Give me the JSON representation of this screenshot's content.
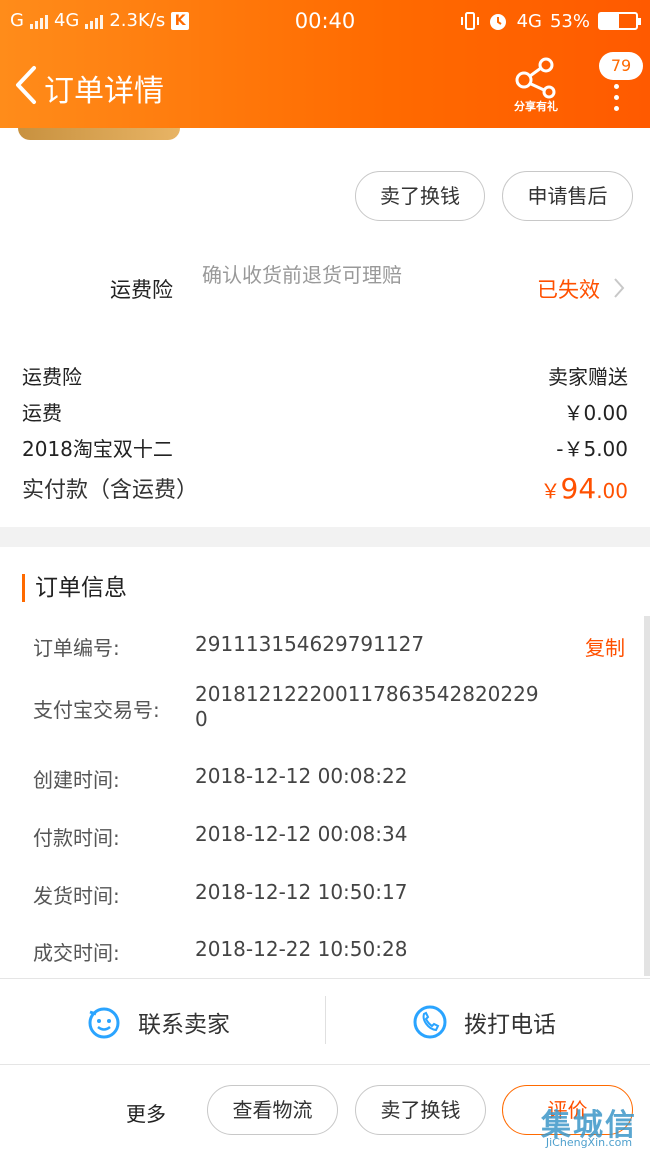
{
  "status_bar": {
    "network_left": "G",
    "network_mid": "4G",
    "speed": "2.3K/s",
    "k_badge": "K",
    "time": "00:40",
    "network_right": "4G",
    "battery": "53%",
    "battery_level": 0.53
  },
  "nav": {
    "title": "订单详情",
    "share_label": "分享有礼",
    "message_count": "79"
  },
  "actions_top": {
    "sell_exchange": "卖了换钱",
    "after_sale": "申请售后"
  },
  "insurance": {
    "label": "运费险",
    "description": "确认收货前退货可理赔",
    "status": "已失效"
  },
  "price_rows": [
    {
      "label": "运费险",
      "value": "卖家赠送"
    },
    {
      "label": "运费",
      "value": "￥0.00"
    },
    {
      "label": "2018淘宝双十二",
      "value": "-￥5.00"
    }
  ],
  "total": {
    "label": "实付款（含运费）",
    "currency": "￥",
    "integer": "94",
    "decimal": ".00"
  },
  "order_info": {
    "title": "订单信息",
    "copy_label": "复制",
    "rows": [
      {
        "label": "订单编号:",
        "value": "291113154629791127"
      },
      {
        "label": "支付宝交易号:",
        "value": "2018121222001178635428202290"
      },
      {
        "label": "创建时间:",
        "value": "2018-12-12 00:08:22"
      },
      {
        "label": "付款时间:",
        "value": "2018-12-12 00:08:34"
      },
      {
        "label": "发货时间:",
        "value": "2018-12-12 10:50:17"
      },
      {
        "label": "成交时间:",
        "value": "2018-12-22 10:50:28"
      }
    ]
  },
  "contact": {
    "seller": "联系卖家",
    "phone": "拨打电话"
  },
  "bottom_bar": {
    "more": "更多",
    "logistics": "查看物流",
    "sell_exchange": "卖了换钱",
    "review": "评价"
  },
  "watermark": {
    "cn": "集城信",
    "en": "JiChengXin.com"
  },
  "colors": {
    "brand_orange": "#ff6a00",
    "price_red": "#ff5000",
    "contact_blue": "#2aa4ff"
  }
}
